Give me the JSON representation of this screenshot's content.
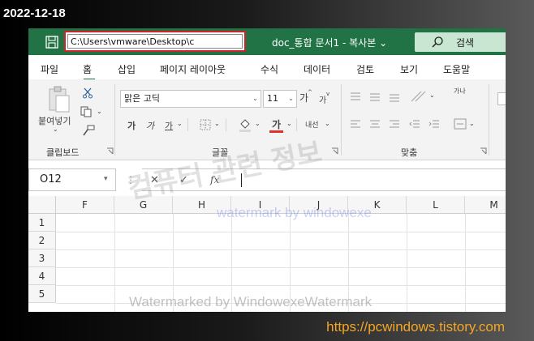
{
  "date_label": "2022-12-18",
  "footer_url": "https://pcwindows.tistory.com",
  "titlebar": {
    "path": "C:\\Users\\vmware\\Desktop\\c",
    "doc_title": "doc_통합 문서1 - 복사본",
    "doc_title_chevron": "⌄",
    "qat_dropdown": "⊽",
    "search_label": "검색",
    "accent": "#217346",
    "highlight": "#d0222a"
  },
  "tabs": [
    "파일",
    "홈",
    "삽입",
    "페이지 레이아웃",
    "수식",
    "데이터",
    "검토",
    "보기",
    "도움말"
  ],
  "ribbon": {
    "clipboard_label": "클립보드",
    "paste_label": "붙여넣기",
    "font_group_label": "글꼴",
    "font_name": "맑은 고딕",
    "font_size": "11",
    "grow_font": "가",
    "shrink_font": "가",
    "bold": "가",
    "italic": "가",
    "underline": "가",
    "font_color_glyph": "가",
    "phonetic": "내선",
    "align_group_label": "맞춤",
    "wrap_glyph": "가나"
  },
  "formula_bar": {
    "name_box": "O12",
    "cancel": "✕",
    "enter": "✓",
    "fx": "fx"
  },
  "grid": {
    "columns": [
      "F",
      "G",
      "H",
      "I",
      "J",
      "K",
      "L",
      "M"
    ],
    "rows": [
      "1",
      "2",
      "3",
      "4",
      "5"
    ]
  },
  "watermarks": {
    "center": "컴퓨터 관련 정보",
    "blue": "watermark by windowexe",
    "bottom": "Watermarked by WindowexeWatermark"
  }
}
